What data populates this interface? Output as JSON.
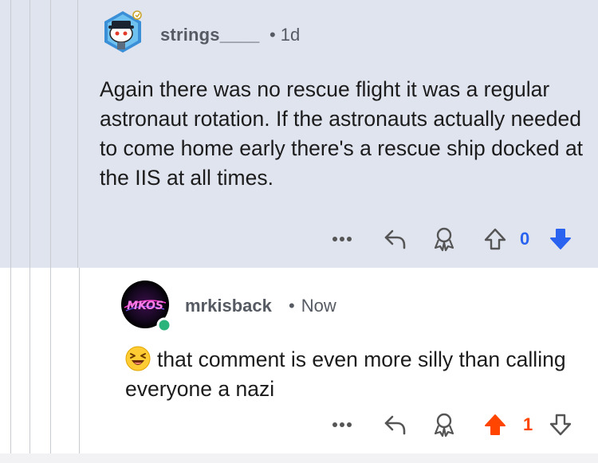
{
  "comments": [
    {
      "username": "strings____",
      "separator": "•",
      "time": "1d",
      "text": "Again there was no rescue flight it was a regular astronaut rotation. If the astronauts actually needed to come home early there's a rescue ship docked at the IIS at all times.",
      "vote_count": "0",
      "vote_state": "downvoted",
      "avatar_icon": "snoo-avatar-icon",
      "actions": [
        "more-icon",
        "reply-icon",
        "award-icon",
        "upvote-icon",
        "downvote-icon"
      ]
    },
    {
      "username": "mrkisback",
      "separator": "•",
      "time": "Now",
      "emoji": "laughing-face-emoji",
      "text": "that comment is even more silly than calling everyone a nazi",
      "vote_count": "1",
      "vote_state": "upvoted",
      "online": true,
      "avatar_icon": "neon-logo-avatar-icon",
      "actions": [
        "more-icon",
        "reply-icon",
        "award-icon",
        "upvote-icon",
        "downvote-icon"
      ]
    }
  ],
  "colors": {
    "upvote": "#ff4500",
    "downvote": "#2a63f0",
    "online": "#2ab37a",
    "parent_background": "#e0e4ef"
  }
}
